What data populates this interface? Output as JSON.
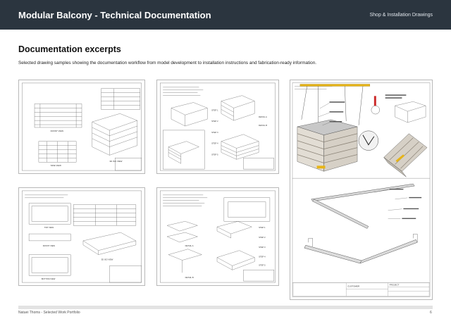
{
  "header": {
    "title": "Modular Balcony - Technical Documentation",
    "section_label": "Shop & Installation Drawings"
  },
  "content": {
    "heading": "Documentation excerpts",
    "intro": "Selected drawing samples showing the documentation workflow from model development to installation instructions and fabrication-ready information."
  },
  "sheets": {
    "a": {
      "v1": "FRONT VIEW",
      "v2": "SIDE VIEW",
      "v3": "3D ISO VIEW"
    },
    "b": {
      "s1": "STEP 1",
      "s2": "STEP 2",
      "s3": "STEP 3",
      "s4": "STEP 4",
      "s5": "STEP 5",
      "d1": "DETAIL A",
      "d2": "DETAIL B"
    },
    "c": {
      "v1": "TOP VIEW",
      "v2": "FRONT VIEW",
      "v3": "BOTTOM VIEW",
      "v4": "3D ISO VIEW"
    },
    "d": {
      "s1": "STEP 1",
      "s2": "STEP 2",
      "s3": "STEP 3",
      "s4": "STEP 4",
      "s5": "STEP 5",
      "d1": "DETAIL A",
      "d2": "DETAIL B"
    },
    "e": {
      "customer": "CUSTOMER",
      "project": "PROJECT"
    }
  },
  "footer": {
    "credit": "Natuei Thoms - Selected Work Portfolio",
    "page": "6"
  },
  "colors": {
    "header_bg": "#2b353f",
    "header_text": "#ffffff",
    "accent_yellow": "#e7b416",
    "accent_red": "#cc2a2a"
  }
}
